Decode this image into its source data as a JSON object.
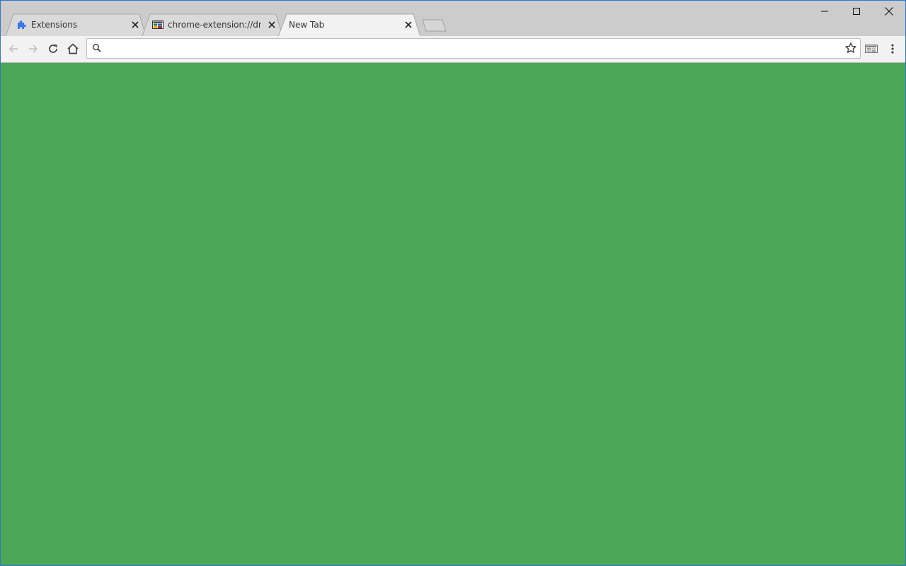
{
  "browser": {
    "tabs": [
      {
        "title": "Extensions",
        "icon": "puzzle-icon",
        "active": false
      },
      {
        "title": "chrome-extension://dmkl",
        "icon": "extension-favicon-icon",
        "active": false
      },
      {
        "title": "New Tab",
        "icon": "",
        "active": true
      }
    ],
    "window_controls": [
      "minimize-icon",
      "maximize-icon",
      "close-icon"
    ]
  },
  "toolbar": {
    "omnibox_value": "",
    "buttons": [
      "back-icon",
      "forward-icon",
      "reload-icon",
      "home-icon"
    ],
    "extension_icon": "extension-favicon-icon",
    "menu_icon": "kebab-menu-icon"
  },
  "content": {
    "background": "#4ca856"
  },
  "colors": {
    "titlebar": "#cccccc",
    "active_tab": "#f2f2f2",
    "inactive_tab": "#dadada",
    "window_border": "#2b78d0"
  }
}
